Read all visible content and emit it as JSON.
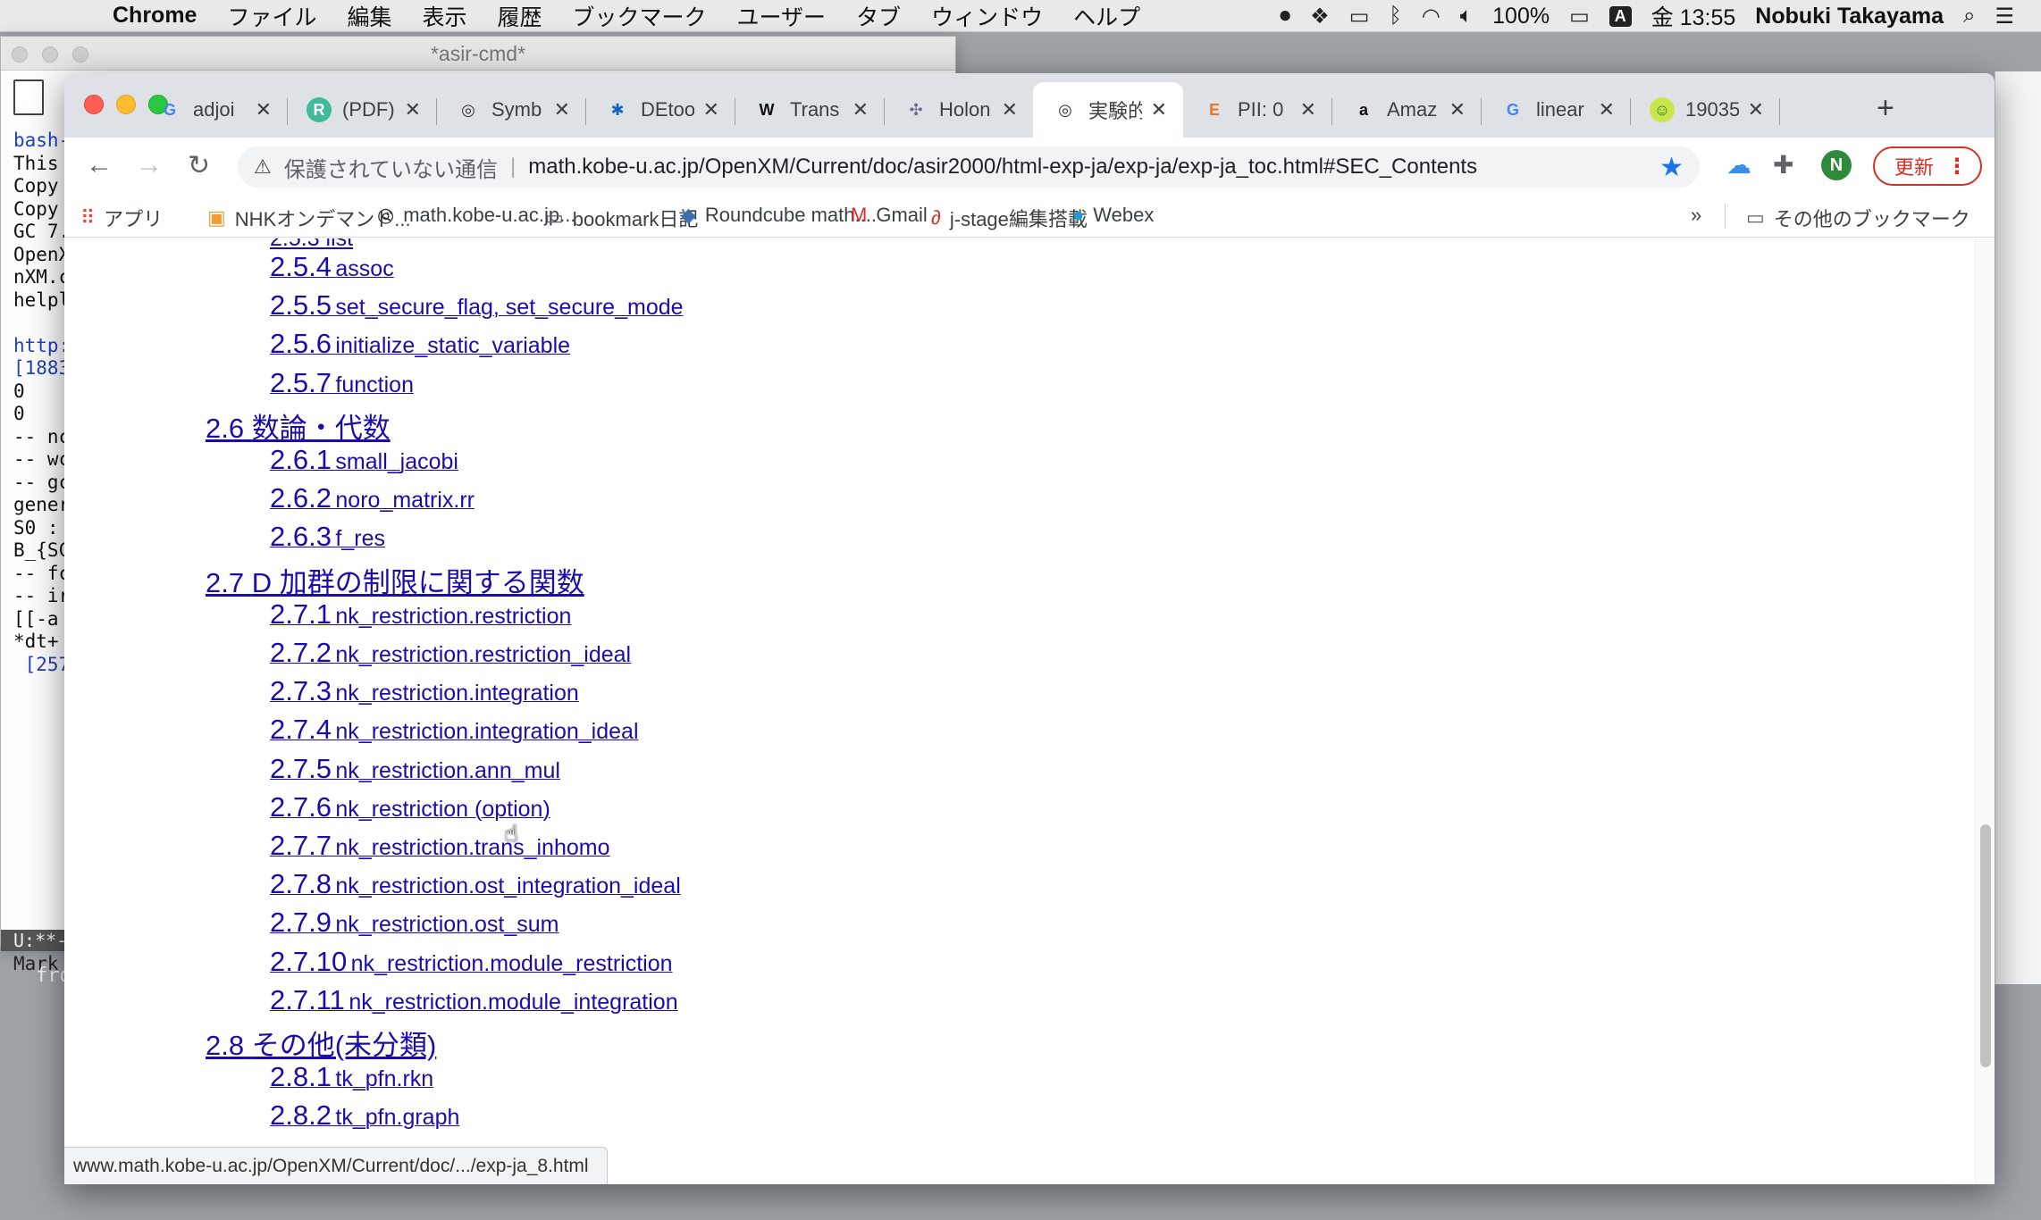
{
  "menubar": {
    "app": "Chrome",
    "items": [
      "ファイル",
      "編集",
      "表示",
      "履歴",
      "ブックマーク",
      "ユーザー",
      "タブ",
      "ウィンドウ",
      "ヘルプ"
    ],
    "battery": "100%",
    "input_badge": "A",
    "clock": "金 13:55",
    "user": "Nobuki Takayama"
  },
  "terminal": {
    "title": "*asir-cmd*",
    "lines": [
      "bash-",
      "This ",
      "Copy",
      "Copy",
      "GC 7.",
      "OpenX",
      "nXM.c",
      "helpl",
      "",
      "http:",
      "[1883",
      "0",
      "0",
      "-- nc",
      "-- wc",
      "-- gc",
      "gener",
      "S0 :",
      "B_{SC",
      "-- fc",
      "-- ir",
      "[[-a",
      "*dt+",
      " [257"
    ],
    "modeline": "U:**-",
    "mark": "Mark",
    "from": "fro"
  },
  "tabs": [
    {
      "title": "adjoi",
      "icon": "G",
      "icon_color": "#4285f4",
      "icon_bg": "transparent"
    },
    {
      "title": "(PDF)",
      "icon": "R",
      "icon_color": "#ffffff",
      "icon_bg": "#40ba9b"
    },
    {
      "title": "Symb",
      "icon": "◎",
      "icon_color": "#333333",
      "icon_bg": "transparent"
    },
    {
      "title": "DEtoo",
      "icon": "✱",
      "icon_color": "#1565c0",
      "icon_bg": "transparent"
    },
    {
      "title": "Trans",
      "icon": "W",
      "icon_color": "#111111",
      "icon_bg": "transparent"
    },
    {
      "title": "Holon",
      "icon": "✣",
      "icon_color": "#6a6a8a",
      "icon_bg": "transparent"
    },
    {
      "title": "実験的",
      "icon": "◎",
      "icon_color": "#333333",
      "icon_bg": "transparent"
    },
    {
      "title": "PII: 0",
      "icon": "E",
      "icon_color": "#e8792b",
      "icon_bg": "transparent"
    },
    {
      "title": "Amaz",
      "icon": "a",
      "icon_color": "#111111",
      "icon_bg": "transparent"
    },
    {
      "title": "linear",
      "icon": "G",
      "icon_color": "#4285f4",
      "icon_bg": "transparent"
    },
    {
      "title": "19035",
      "icon": "☺",
      "icon_color": "#2e7d32",
      "icon_bg": "#c8e64a"
    }
  ],
  "active_tab_index": 6,
  "tab_close": "✕",
  "new_tab": "+",
  "toolbar": {
    "back": "←",
    "forward": "→",
    "reload": "↻",
    "security_text": "保護されていない通信",
    "url": "math.kobe-u.ac.jp/OpenXM/Current/doc/asir2000/html-exp-ja/exp-ja/exp-ja_toc.html#SEC_Contents",
    "avatar_letter": "N",
    "update_label": "更新",
    "menu_dots": "⋮"
  },
  "bookmarks": [
    {
      "label": "アプリ",
      "icon": "⠿",
      "icon_color": "#e8453c"
    },
    {
      "label": "NHKオンデマンド...",
      "icon": "▣",
      "icon_color": "#f29c38"
    },
    {
      "label": "math.kobe-u.ac.jp...",
      "icon": "◎",
      "icon_color": "#333333"
    },
    {
      "label": "bookmark日記",
      "icon": "▭",
      "icon_color": "#5f6368"
    },
    {
      "label": "Roundcube math....",
      "icon": "◆",
      "icon_color": "#3a6fb0"
    },
    {
      "label": "Gmail",
      "icon": "M",
      "icon_color": "#d93025"
    },
    {
      "label": "j-stage編集搭載",
      "icon": "∂",
      "icon_color": "#c0392b"
    },
    {
      "label": "Webex",
      "icon": "●",
      "icon_color": "#1f9bd7"
    },
    {
      "label": "その他のブックマーク",
      "icon": "▭",
      "icon_color": "#5f6368"
    }
  ],
  "bookmarks_more": "»",
  "toc": {
    "cut_top": "2.5.3 list",
    "entries": [
      {
        "level": 3,
        "num": "2.5.4",
        "text": "assoc"
      },
      {
        "level": 3,
        "num": "2.5.5",
        "text": "set_secure_flag, set_secure_mode"
      },
      {
        "level": 3,
        "num": "2.5.6",
        "text": "initialize_static_variable"
      },
      {
        "level": 3,
        "num": "2.5.7",
        "text": "function"
      },
      {
        "level": 2,
        "num": "2.6",
        "text": "数論・代数"
      },
      {
        "level": 3,
        "num": "2.6.1",
        "text": "small_jacobi"
      },
      {
        "level": 3,
        "num": "2.6.2",
        "text": "noro_matrix.rr"
      },
      {
        "level": 3,
        "num": "2.6.3",
        "text": "f_res"
      },
      {
        "level": 2,
        "num": "2.7",
        "text": "D 加群の制限に関する関数"
      },
      {
        "level": 3,
        "num": "2.7.1",
        "text": "nk_restriction.restriction"
      },
      {
        "level": 3,
        "num": "2.7.2",
        "text": "nk_restriction.restriction_ideal"
      },
      {
        "level": 3,
        "num": "2.7.3",
        "text": "nk_restriction.integration"
      },
      {
        "level": 3,
        "num": "2.7.4",
        "text": "nk_restriction.integration_ideal"
      },
      {
        "level": 3,
        "num": "2.7.5",
        "text": "nk_restriction.ann_mul"
      },
      {
        "level": 3,
        "num": "2.7.6",
        "text": "nk_restriction (option)"
      },
      {
        "level": 3,
        "num": "2.7.7",
        "text": "nk_restriction.trans_inhomo"
      },
      {
        "level": 3,
        "num": "2.7.8",
        "text": "nk_restriction.ost_integration_ideal"
      },
      {
        "level": 3,
        "num": "2.7.9",
        "text": "nk_restriction.ost_sum"
      },
      {
        "level": 3,
        "num": "2.7.10",
        "text": "nk_restriction.module_restriction"
      },
      {
        "level": 3,
        "num": "2.7.11",
        "text": "nk_restriction.module_integration"
      },
      {
        "level": 2,
        "num": "2.8",
        "text": "その他(未分類)"
      },
      {
        "level": 3,
        "num": "2.8.1",
        "text": "tk_pfn.rkn"
      },
      {
        "level": 3,
        "num": "2.8.2",
        "text": "tk_pfn.graph"
      }
    ]
  },
  "status_url": "www.math.kobe-u.ac.jp/OpenXM/Current/doc/.../exp-ja_8.html",
  "colors": {
    "link": "#1a0dab",
    "update_red": "#d93025",
    "star_blue": "#1a73e8",
    "avatar_green": "#2e8b3c"
  }
}
